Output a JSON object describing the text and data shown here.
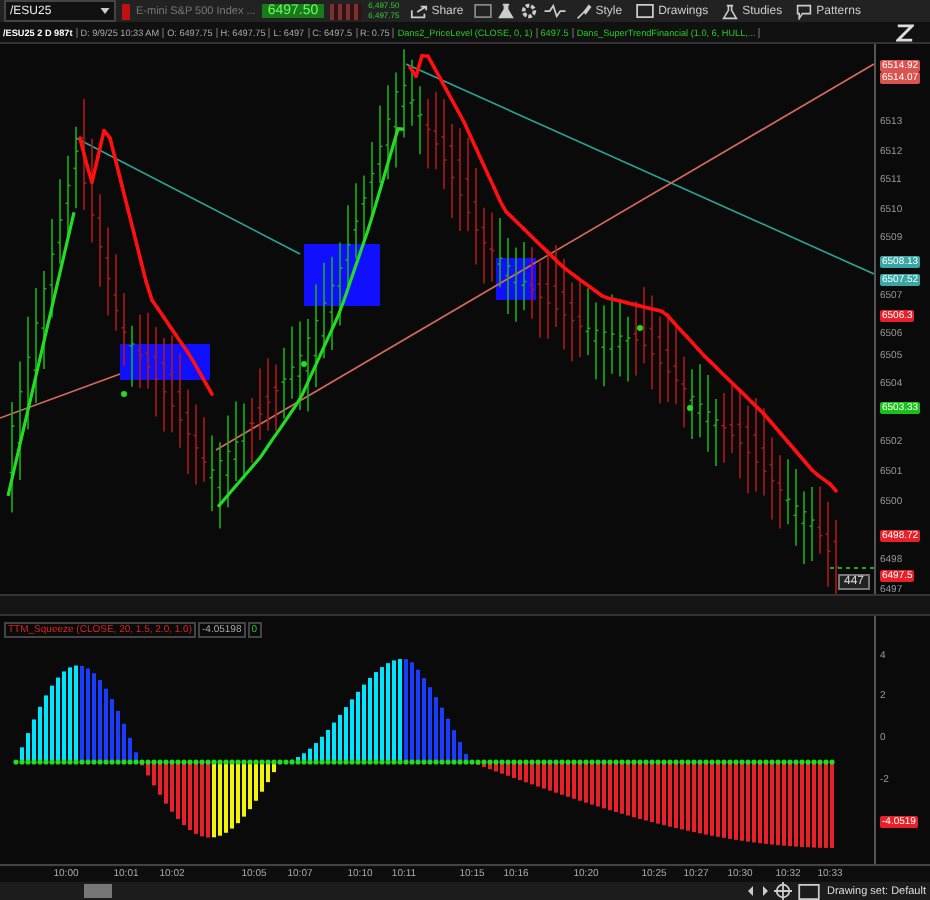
{
  "toolbar": {
    "symbol": "/ESU25",
    "description": "E-mini S&P 500 Index ...",
    "last": "6497.50",
    "quotes": [
      "6,497.50",
      "6,497.75"
    ],
    "buttons": [
      {
        "label": "Share",
        "kind": "share"
      },
      {
        "label": "Style",
        "kind": "style"
      },
      {
        "label": "Drawings",
        "kind": "drawings"
      },
      {
        "label": "Studies",
        "kind": "studies"
      },
      {
        "label": "Patterns",
        "kind": "patterns"
      }
    ]
  },
  "info_bar": [
    {
      "text": "/ESU25 2 D 987t",
      "kind": "title"
    },
    {
      "text": "D: 9/9/25 10:33 AM",
      "kind": "plain"
    },
    {
      "text": "O: 6497.75",
      "kind": "plain"
    },
    {
      "text": "H: 6497.75",
      "kind": "plain"
    },
    {
      "text": "L: 6497",
      "kind": "plain"
    },
    {
      "text": "C: 6497.5",
      "kind": "plain"
    },
    {
      "text": "R: 0.75",
      "kind": "plain"
    },
    {
      "text": "Dans2_PriceLevel (CLOSE, 0, 1)",
      "kind": "study"
    },
    {
      "text": "6497.5",
      "kind": "study"
    },
    {
      "text": "Dans_SuperTrendFinancial (1.0, 6, HULL,...",
      "kind": "study"
    }
  ],
  "price_axis": [
    {
      "label": "6514.92",
      "color": "#d9534f"
    },
    {
      "label": "6514.07",
      "color": "#d9534f"
    },
    {
      "label": "6513"
    },
    {
      "label": "6512"
    },
    {
      "label": "6511"
    },
    {
      "label": "6510"
    },
    {
      "label": "6509"
    },
    {
      "label": "6508.13",
      "color": "#3aa6a6"
    },
    {
      "label": "6507.52",
      "color": "#3aa6a6"
    },
    {
      "label": "6507"
    },
    {
      "label": "6506.3",
      "color": "#e8202a"
    },
    {
      "label": "6506"
    },
    {
      "label": "6505"
    },
    {
      "label": "6504"
    },
    {
      "label": "6503.33",
      "color": "#19c219"
    },
    {
      "label": "6502"
    },
    {
      "label": "6501"
    },
    {
      "label": "6500"
    },
    {
      "label": "6498.72",
      "color": "#e8202a"
    },
    {
      "label": "6498"
    },
    {
      "label": "6497.5",
      "color": "#e8202a"
    },
    {
      "label": "6497"
    }
  ],
  "bar_count": "447",
  "lower_pane": {
    "study": "TTM_Squeeze (CLOSE, 20, 1.5, 2.0, 1.0)",
    "value": "-4.05198",
    "signal": "0",
    "axis": [
      {
        "label": "4"
      },
      {
        "label": "2"
      },
      {
        "label": "0"
      },
      {
        "label": "-2"
      },
      {
        "label": "-4.0519",
        "color": "#e8202a"
      }
    ]
  },
  "time_axis": [
    "10:00",
    "10:01",
    "10:02",
    "10:05",
    "10:07",
    "10:10",
    "10:11",
    "10:15",
    "10:16",
    "10:20",
    "10:25",
    "10:27",
    "10:30",
    "10:32",
    "10:33"
  ],
  "status": "Drawing set: Default"
}
